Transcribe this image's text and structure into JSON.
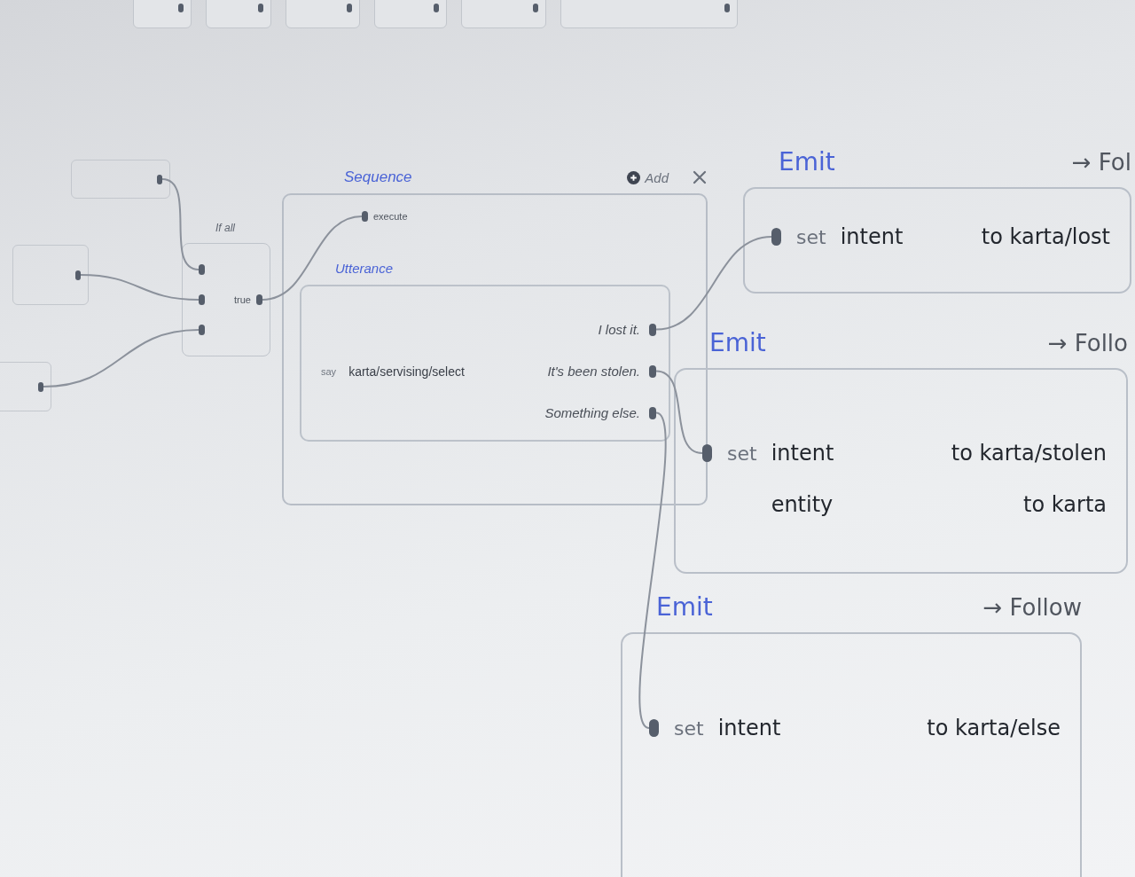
{
  "if_all": {
    "title": "If all",
    "output": "true"
  },
  "sequence": {
    "title": "Sequence",
    "add_label": "Add",
    "input_port": "execute",
    "utterance": {
      "title": "Utterance",
      "verb": "say",
      "path": "karta/servising/select",
      "options": [
        "I lost it.",
        "It's been stolen.",
        "Something else."
      ]
    }
  },
  "emits": [
    {
      "title": "Emit",
      "follow": "→ Fol",
      "rows": [
        {
          "verb": "set",
          "field": "intent",
          "value": "to karta/lost"
        }
      ]
    },
    {
      "title": "Emit",
      "follow": "→ Follo",
      "rows": [
        {
          "verb": "set",
          "field": "intent",
          "value": "to karta/stolen"
        },
        {
          "field": "entity",
          "value": "to karta"
        }
      ]
    },
    {
      "title": "Emit",
      "follow": "→ Follow",
      "rows": [
        {
          "verb": "set",
          "field": "intent",
          "value": "to karta/else"
        }
      ]
    }
  ]
}
